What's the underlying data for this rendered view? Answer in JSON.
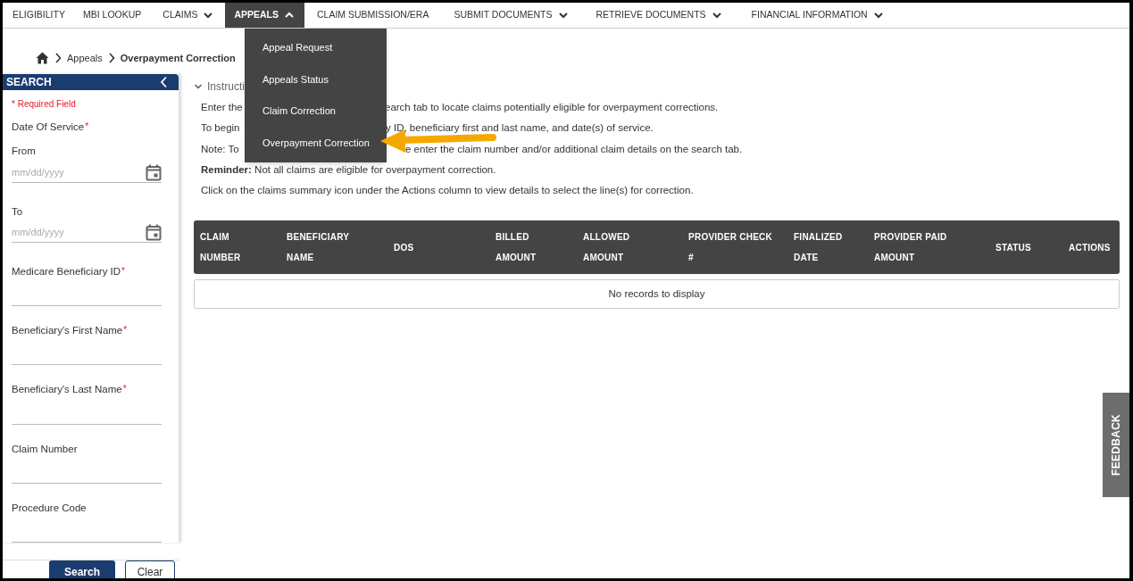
{
  "nav": [
    {
      "label": "ELIGIBILITY",
      "caret": false,
      "selected": false
    },
    {
      "label": "MBI LOOKUP",
      "caret": false,
      "selected": false
    },
    {
      "label": "CLAIMS",
      "caret": true,
      "selected": false,
      "expanded": false
    },
    {
      "label": "APPEALS",
      "caret": true,
      "selected": true,
      "expanded": true
    },
    {
      "label": "CLAIM SUBMISSION/ERA",
      "caret": false,
      "selected": false
    },
    {
      "label": "SUBMIT DOCUMENTS",
      "caret": true,
      "selected": false,
      "expanded": false
    },
    {
      "label": "RETRIEVE DOCUMENTS",
      "caret": true,
      "selected": false,
      "expanded": false
    },
    {
      "label": "FINANCIAL INFORMATION",
      "caret": true,
      "selected": false,
      "expanded": false
    }
  ],
  "dropdown": {
    "items": [
      {
        "label": "Appeal Request"
      },
      {
        "label": "Appeals Status"
      },
      {
        "label": "Claim Correction"
      },
      {
        "label": "Overpayment Correction"
      }
    ]
  },
  "breadcrumb": [
    {
      "label": "Appeals"
    },
    {
      "label": "Overpayment Correction"
    }
  ],
  "sidebar": {
    "title": "SEARCH",
    "required_note": "* Required Field",
    "fields": [
      {
        "kind": "group",
        "label": "Date Of Service",
        "required_mark": "*"
      },
      {
        "kind": "date",
        "label": "From",
        "placeholder": "mm/dd/yyyy"
      },
      {
        "kind": "date",
        "label": "To",
        "placeholder": "mm/dd/yyyy"
      },
      {
        "kind": "text",
        "label": "Medicare Beneficiary ID",
        "required_mark": "*"
      },
      {
        "kind": "text",
        "label": "Beneficiary's First Name",
        "required_mark": "*"
      },
      {
        "kind": "text",
        "label": "Beneficiary's Last Name",
        "required_mark": "*"
      },
      {
        "kind": "text",
        "label": "Claim Number"
      },
      {
        "kind": "text",
        "label": "Procedure Code"
      }
    ],
    "buttons": [
      {
        "label": "Search",
        "kind": "primary"
      },
      {
        "label": "Clear",
        "kind": "secondary"
      }
    ]
  },
  "instructions": {
    "title": "Instructi",
    "expanded": true,
    "lines": [
      {
        "before": "Enter the",
        "after": "earch tab to locate claims potentially eligible for overpayment corrections."
      },
      {
        "before": "To begin",
        "after": "y ID, beneficiary first and last name, and date(s) of service."
      },
      {
        "before": "Note: To",
        "after": "e enter the claim number and/or additional claim details on the search tab."
      },
      {
        "before": "**Reminder:** Not all claims are eligible for overpayment correction."
      },
      {
        "before": "Click on the claims summary icon under the Actions column to view details to select the line(s) for correction."
      }
    ]
  },
  "table": {
    "columns": [
      "CLAIM\nNUMBER",
      "BENEFICIARY\nNAME",
      "DOS",
      "BILLED\nAMOUNT",
      "ALLOWED\nAMOUNT",
      "PROVIDER CHECK\n#",
      "FINALIZED\nDATE",
      "PROVIDER PAID\nAMOUNT",
      "STATUS",
      "ACTIONS"
    ],
    "empty_message": "No records to display"
  },
  "feedback": "FEEDBACK"
}
